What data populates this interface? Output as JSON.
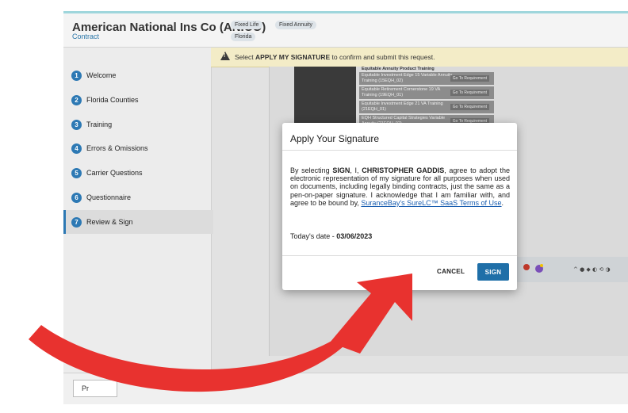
{
  "header": {
    "company": "American National Ins Co (ANICO)",
    "subtitle": "Contract",
    "chips": [
      "Fixed Life",
      "Fixed Annuity",
      "Florida"
    ]
  },
  "banner": {
    "pre": "Select ",
    "strong": "APPLY MY SIGNATURE",
    "post": " to confirm and submit this request."
  },
  "sidebar": {
    "items": [
      {
        "num": "1",
        "label": "Welcome"
      },
      {
        "num": "2",
        "label": "Florida Counties"
      },
      {
        "num": "3",
        "label": "Training"
      },
      {
        "num": "4",
        "label": "Errors & Omissions"
      },
      {
        "num": "5",
        "label": "Carrier Questions"
      },
      {
        "num": "6",
        "label": "Questionnaire"
      },
      {
        "num": "7",
        "label": "Review & Sign"
      }
    ]
  },
  "training_doc": {
    "heading": "Equitable Annuity Product Training",
    "rows": [
      {
        "title": "Equitable Investment Edge 15 Variable Annuity Training (15EQH_02)",
        "button": "Go To Requirement"
      },
      {
        "title": "Equitable Retirement Cornerstone 19 VA Training (19EQH_01)",
        "button": "Go To Requirement"
      },
      {
        "title": "Equitable Investment Edge 21 VA Training (21EQH_01)",
        "button": "Go To Requirement"
      },
      {
        "title": "EQH Structured Capital Strategies Variable Annuity (21EQH_02)",
        "button": "Go To Requirement"
      }
    ]
  },
  "modal": {
    "title": "Apply Your Signature",
    "p1": "By selecting ",
    "sign_word": "SIGN",
    "p2": ", I, ",
    "name": "CHRISTOPHER GADDIS",
    "p3": ", agree to adopt the electronic representation of my signature for all purposes when used on documents, including legally binding contracts, just the same as a pen-on-paper signature. I acknowledge that I am familiar with, and agree to be bound by, ",
    "link": "SuranceBay's SureLC™ SaaS Terms of Use",
    "p4": ".",
    "date_label": "Today's date - ",
    "date_value": "03/06/2023",
    "cancel": "CANCEL",
    "sign": "SIGN"
  },
  "footer": {
    "prev": "Pr"
  },
  "colors": {
    "accent": "#1f6fa8",
    "arrow": "#e8322f",
    "banner_bg": "#f3ecc7"
  }
}
